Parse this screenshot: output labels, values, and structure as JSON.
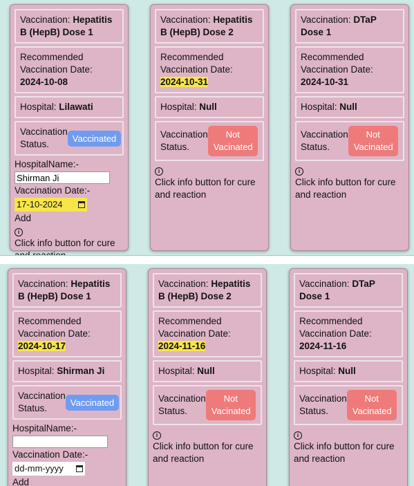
{
  "top": {
    "cards": [
      {
        "vaccination_label": "Vaccination:",
        "vaccination_name": "Hepatitis B (HepB) Dose 1",
        "rec_label": "Recommended Vaccination Date:",
        "rec_date": "2024-10-08",
        "hospital_label": "Hospital:",
        "hospital_value": "Lilawati",
        "status_label": "Vaccination Status.",
        "status_button": "Vaccinated",
        "hospital_name_label": "HospitalName:-",
        "hospital_name_value": "Shirman Ji",
        "vacc_date_label": "Vaccination Date:-",
        "vacc_date_value": "17-10-2024",
        "add_label": "Add",
        "info_text": "Click info button for cure and reaction"
      },
      {
        "vaccination_label": "Vaccination:",
        "vaccination_name": "Hepatitis B (HepB) Dose 2",
        "rec_label": "Recommended Vaccination Date:",
        "rec_date": "2024-10-31",
        "hospital_label": "Hospital:",
        "hospital_value": "Null",
        "status_label": "Vaccination Status.",
        "status_button": "Not Vacinated",
        "info_text": "Click info button for cure and reaction"
      },
      {
        "vaccination_label": "Vaccination:",
        "vaccination_name": "DTaP Dose 1",
        "rec_label": "Recommended Vaccination Date:",
        "rec_date": "2024-10-31",
        "hospital_label": "Hospital:",
        "hospital_value": "Null",
        "status_label": "Vaccination Status.",
        "status_button": "Not Vacinated",
        "info_text": "Click info button for cure and reaction"
      }
    ]
  },
  "bottom": {
    "cards": [
      {
        "vaccination_label": "Vaccination:",
        "vaccination_name": "Hepatitis B (HepB) Dose 1",
        "rec_label": "Recommended Vaccination Date:",
        "rec_date": "2024-10-17",
        "hospital_label": "Hospital:",
        "hospital_value": "Shirman Ji",
        "status_label": "Vaccination Status.",
        "status_button": "Vaccinated",
        "hospital_name_label": "HospitalName:-",
        "hospital_name_value": "",
        "vacc_date_label": "Vaccination Date:-",
        "vacc_date_value": "dd-mm-yyyy",
        "add_label": "Add"
      },
      {
        "vaccination_label": "Vaccination:",
        "vaccination_name": "Hepatitis B (HepB) Dose 2",
        "rec_label": "Recommended Vaccination Date:",
        "rec_date": "2024-11-16",
        "hospital_label": "Hospital:",
        "hospital_value": "Null",
        "status_label": "Vaccination Status.",
        "status_button": "Not Vacinated",
        "info_text": "Click info button for cure and reaction"
      },
      {
        "vaccination_label": "Vaccination:",
        "vaccination_name": "DTaP Dose 1",
        "rec_label": "Recommended Vaccination Date:",
        "rec_date": "2024-11-16",
        "hospital_label": "Hospital:",
        "hospital_value": "Null",
        "status_label": "Vaccination Status.",
        "status_button": "Not Vacinated",
        "info_text": "Click info button for cure and reaction"
      }
    ]
  },
  "colors": {
    "card_bg": "#ddb5c7",
    "vaccinated_btn": "#6f9cf0",
    "not_vaccinated_btn": "#ef7a7a",
    "highlight": "#f7e54a",
    "background": "#cfe9e7"
  },
  "icons": {
    "info": "info-icon",
    "calendar": "calendar-icon"
  }
}
